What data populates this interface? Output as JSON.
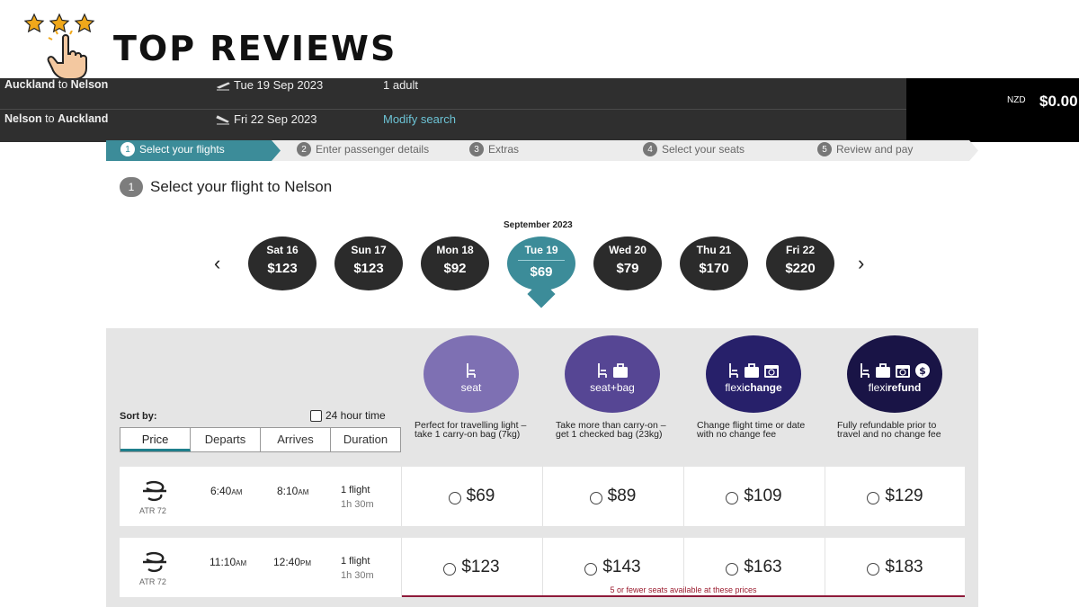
{
  "brand": {
    "title": "TOP REVIEWS",
    "star_color": "#f0a81a"
  },
  "search": {
    "outbound": {
      "from": "Auckland",
      "sep": " to ",
      "to": "Nelson",
      "date": "Tue 19 Sep 2023",
      "extra": "1 adult"
    },
    "inbound": {
      "from": "Nelson",
      "sep": " to ",
      "to": "Auckland",
      "date": "Fri 22 Sep 2023",
      "extra": "Modify search"
    }
  },
  "total": {
    "currency": "NZD",
    "amount": "$0.00"
  },
  "steps": [
    {
      "num": "1",
      "label": "Select your flights"
    },
    {
      "num": "2",
      "label": "Enter passenger details"
    },
    {
      "num": "3",
      "label": "Extras"
    },
    {
      "num": "4",
      "label": "Select your seats"
    },
    {
      "num": "5",
      "label": "Review and pay"
    }
  ],
  "section": {
    "num": "1",
    "title": "Select your flight to Nelson"
  },
  "calendar": {
    "month": "September 2023",
    "prev_icon": "‹",
    "next_icon": "›",
    "days": [
      {
        "label": "Sat 16",
        "price": "$123"
      },
      {
        "label": "Sun 17",
        "price": "$123"
      },
      {
        "label": "Mon 18",
        "price": "$92"
      },
      {
        "label": "Tue 19",
        "price": "$69"
      },
      {
        "label": "Wed 20",
        "price": "$79"
      },
      {
        "label": "Thu 21",
        "price": "$170"
      },
      {
        "label": "Fri 22",
        "price": "$220"
      }
    ]
  },
  "fares": [
    {
      "name": "seat",
      "color": "#7e70b3",
      "desc": "Perfect for travelling light – take 1 carry-on bag (7kg)"
    },
    {
      "name": "seat+bag",
      "color": "#564694",
      "desc": "Take more than carry-on – get 1 checked bag (23kg)"
    },
    {
      "name_a": "flexi",
      "name_b": "change",
      "color": "#27206a",
      "desc": "Change flight time or date with no change fee"
    },
    {
      "name_a": "flexi",
      "name_b": "refund",
      "color": "#191446",
      "desc": "Fully refundable prior to travel and no change fee"
    }
  ],
  "sort": {
    "label": "Sort by:",
    "hour24": "24 hour time",
    "tabs": [
      "Price",
      "Departs",
      "Arrives",
      "Duration"
    ]
  },
  "flights": [
    {
      "aircraft": "ATR 72",
      "dep": "6:40",
      "dep_suffix": "AM",
      "arr": "8:10",
      "arr_suffix": "AM",
      "stops": "1 flight",
      "duration": "1h 30m",
      "prices": [
        "$69",
        "$89",
        "$109",
        "$129"
      ]
    },
    {
      "aircraft": "ATR 72",
      "dep": "11:10",
      "dep_suffix": "AM",
      "arr": "12:40",
      "arr_suffix": "PM",
      "stops": "1 flight",
      "duration": "1h 30m",
      "prices": [
        "$123",
        "$143",
        "$163",
        "$183"
      ]
    }
  ],
  "seats_note": "5 or fewer seats available at these prices"
}
